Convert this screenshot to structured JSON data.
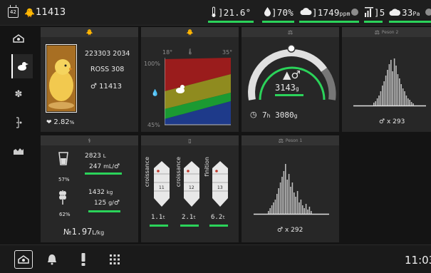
{
  "topbar": {
    "day": "42",
    "flock_count": "11413",
    "temperature": "21.6",
    "temperature_unit": "°",
    "humidity": "70",
    "humidity_unit": "%",
    "co2": "1749",
    "co2_unit": "ppm",
    "fans": "5",
    "pressure": "33",
    "pressure_unit": "Pa",
    "accent_green": "#2bd35a"
  },
  "nav": {
    "items": [
      "house-icon",
      "chick-icon",
      "fan-icon",
      "scale-icon",
      "chart-icon"
    ]
  },
  "flock_card": {
    "lot_number": "223303 2034",
    "breed": "ROSS 308",
    "males": "11413",
    "mortality": "2.82",
    "mortality_unit": "%"
  },
  "climate_card": {
    "temp_min": "18°",
    "temp_max": "35°",
    "humidity_max": "100%",
    "humidity_min": "45%"
  },
  "weight_card": {
    "weight": "3143",
    "weight_unit": "g",
    "time_value": "7",
    "time_unit": "h",
    "gain": "3080",
    "gain_unit": "g"
  },
  "scale2_card": {
    "title": "Peson 2",
    "count": "x 293"
  },
  "consumption_card": {
    "water_total": "2823",
    "water_total_unit": "L",
    "water_per_bird": "247",
    "water_per_bird_unit": "mL/",
    "water_percent": "57",
    "feed_total": "1432",
    "feed_total_unit": "kg",
    "feed_per_bird": "125",
    "feed_per_bird_unit": "g/",
    "feed_percent": "62",
    "ratio": "1.97",
    "ratio_unit": "L/kg"
  },
  "silo_card": {
    "silos": [
      {
        "label": "croissance",
        "number": "11",
        "amount": "1.1",
        "unit": "t"
      },
      {
        "label": "croissance",
        "number": "12",
        "amount": "2.1",
        "unit": "t"
      },
      {
        "label": "finition",
        "number": "13",
        "amount": "6.2",
        "unit": "t"
      }
    ]
  },
  "scale1_card": {
    "title": "Peson 1",
    "count": "x 292"
  },
  "bottombar": {
    "clock": "11:03"
  }
}
